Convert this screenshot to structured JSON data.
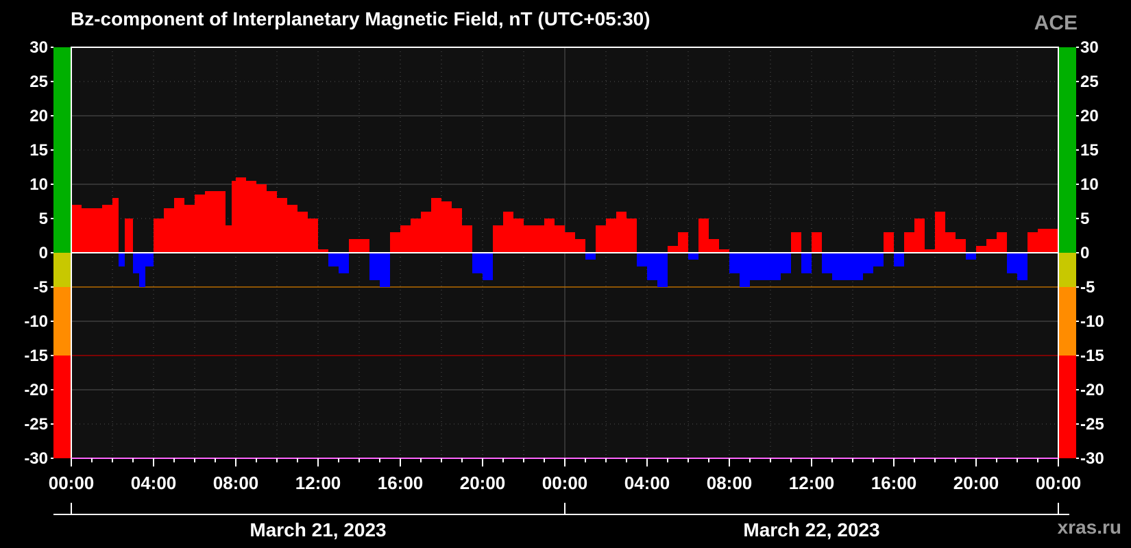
{
  "chart_data": {
    "type": "bar",
    "title": "Bz-component of Interplanetary Magnetic Field, nT (UTC+05:30)",
    "source_label": "ACE",
    "watermark": "xras.ru",
    "ylim": [
      -30,
      30
    ],
    "yticks": [
      30,
      25,
      20,
      15,
      10,
      5,
      0,
      -5,
      -10,
      -15,
      -20,
      -25,
      -30
    ],
    "xlim_hours": [
      0,
      48
    ],
    "xticks": [
      {
        "hour": 0,
        "label": "00:00"
      },
      {
        "hour": 4,
        "label": "04:00"
      },
      {
        "hour": 8,
        "label": "08:00"
      },
      {
        "hour": 12,
        "label": "12:00"
      },
      {
        "hour": 16,
        "label": "16:00"
      },
      {
        "hour": 20,
        "label": "20:00"
      },
      {
        "hour": 24,
        "label": "00:00"
      },
      {
        "hour": 28,
        "label": "04:00"
      },
      {
        "hour": 32,
        "label": "08:00"
      },
      {
        "hour": 36,
        "label": "12:00"
      },
      {
        "hour": 40,
        "label": "16:00"
      },
      {
        "hour": 44,
        "label": "20:00"
      },
      {
        "hour": 48,
        "label": "00:00"
      }
    ],
    "dates": [
      {
        "label": "March 21, 2023",
        "start_hour": 0,
        "end_hour": 24
      },
      {
        "label": "March 22, 2023",
        "start_hour": 24,
        "end_hour": 48
      }
    ],
    "threshold_bands": [
      {
        "from": 0,
        "to": 30,
        "color": "#00b000"
      },
      {
        "from": -5,
        "to": 0,
        "color": "#c8c800"
      },
      {
        "from": -15,
        "to": -5,
        "color": "#ff8c00"
      },
      {
        "from": -30,
        "to": -15,
        "color": "#ff0000"
      }
    ],
    "threshold_lines": [
      {
        "value": -5,
        "color": "#b86a00"
      },
      {
        "value": -15,
        "color": "#a00000"
      }
    ],
    "colors": {
      "positive": "#ff0000",
      "negative": "#0000ff",
      "background": "#000000",
      "plot_background": "#111111",
      "grid": "#555555"
    },
    "series": [
      {
        "x_hours": [
          0.0,
          0.5,
          1.0,
          1.5,
          2.0,
          2.3,
          2.6,
          3.0,
          3.3,
          3.6,
          4.0,
          4.5,
          5.0,
          5.5,
          6.0,
          6.5,
          7.0,
          7.5,
          7.8,
          8.0,
          8.5,
          9.0,
          9.5,
          10.0,
          10.5,
          11.0,
          11.5,
          12.0,
          12.5,
          13.0,
          13.5,
          14.0,
          14.5,
          15.0,
          15.5,
          16.0,
          16.5,
          17.0,
          17.5,
          18.0,
          18.5,
          19.0,
          19.5,
          20.0,
          20.5,
          21.0,
          21.5,
          22.0,
          22.5,
          23.0,
          23.5,
          24.0,
          24.5,
          25.0,
          25.5,
          26.0,
          26.5,
          27.0,
          27.5,
          28.0,
          28.5,
          29.0,
          29.5,
          30.0,
          30.5,
          31.0,
          31.5,
          32.0,
          32.5,
          33.0,
          33.5,
          34.0,
          34.5,
          35.0,
          35.5,
          36.0,
          36.5,
          37.0,
          37.5,
          38.0,
          38.5,
          39.0,
          39.5,
          40.0,
          40.5,
          41.0,
          41.5,
          42.0,
          42.5,
          43.0,
          43.5,
          44.0,
          44.5,
          45.0,
          45.5,
          46.0,
          46.5,
          47.0,
          47.5,
          48.0
        ],
        "values": [
          7,
          6.5,
          6.5,
          7,
          8,
          -2,
          5,
          -3,
          -5,
          -2,
          5,
          6.5,
          8,
          7,
          8.5,
          9,
          9,
          4,
          10.5,
          11,
          10.5,
          10,
          9,
          8,
          7,
          6,
          5,
          0.5,
          -2,
          -3,
          2,
          2,
          -4,
          -5,
          3,
          4,
          5,
          6,
          8,
          7.5,
          6.5,
          4,
          -3,
          -4,
          4,
          6,
          5,
          4,
          4,
          5,
          4,
          3,
          2,
          -1,
          4,
          5,
          6,
          5,
          -2,
          -4,
          -5,
          1,
          3,
          -1,
          5,
          2,
          0.5,
          -3,
          -5,
          -4,
          -4,
          -4,
          -3,
          3,
          -3,
          3,
          -3,
          -4,
          -4,
          -4,
          -3,
          -2,
          3,
          -2,
          3,
          5,
          0.5,
          6,
          3,
          2,
          -1,
          1,
          2,
          3,
          -3,
          -4,
          3,
          3.5,
          3.5,
          3
        ]
      }
    ]
  }
}
